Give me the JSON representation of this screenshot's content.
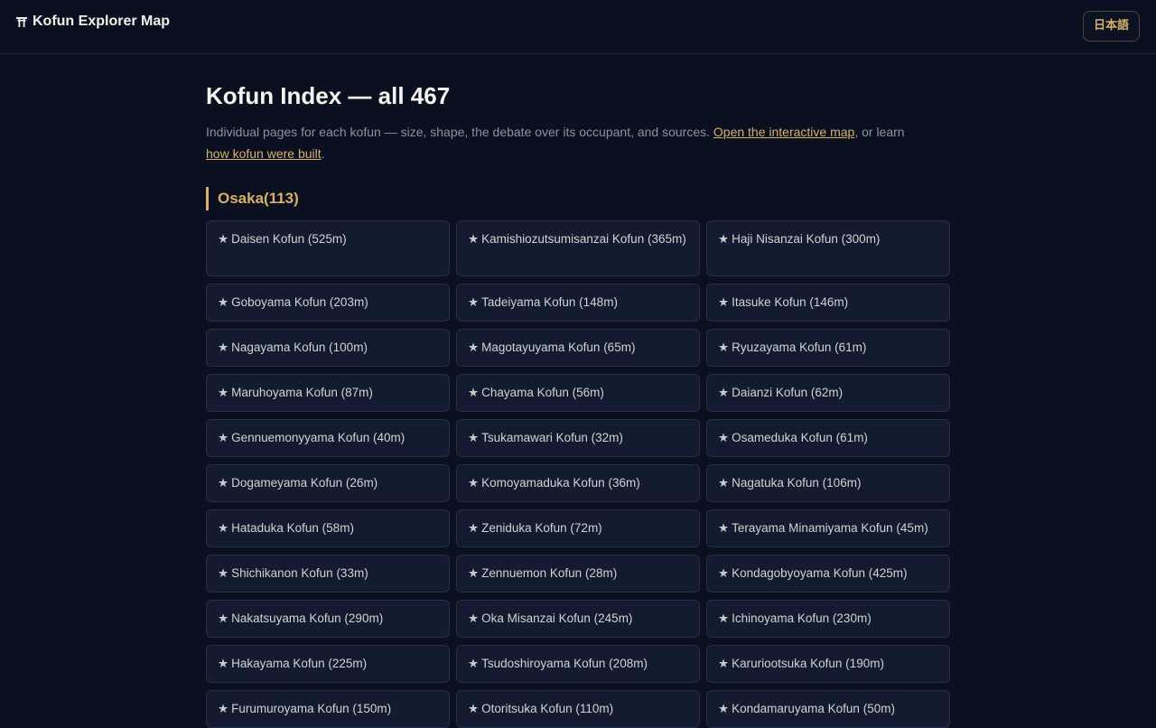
{
  "header": {
    "brand": "Kofun Explorer Map",
    "lang_button": "日本語"
  },
  "main": {
    "title": "Kofun Index — all 467",
    "intro_text": "Individual pages for each kofun — size, shape, the debate over its occupant, and sources. ",
    "map_link": "Open the interactive map",
    "intro_mid": ", or learn ",
    "build_link": "how kofun were built",
    "intro_end": "."
  },
  "region": {
    "heading": "Osaka(113)",
    "items": [
      {
        "label": "Daisen Kofun (525m)"
      },
      {
        "label": "Kamishiozutsumisanzai Kofun (365m)"
      },
      {
        "label": "Haji Nisanzai Kofun (300m)"
      },
      {
        "label": "Goboyama Kofun (203m)"
      },
      {
        "label": "Tadeiyama Kofun (148m)"
      },
      {
        "label": "Itasuke Kofun (146m)"
      },
      {
        "label": "Nagayama Kofun (100m)"
      },
      {
        "label": "Magotayuyama Kofun (65m)"
      },
      {
        "label": "Ryuzayama Kofun (61m)"
      },
      {
        "label": "Maruhoyama Kofun (87m)"
      },
      {
        "label": "Chayama Kofun (56m)"
      },
      {
        "label": "Daianzi Kofun (62m)"
      },
      {
        "label": "Gennuemonyyama Kofun (40m)"
      },
      {
        "label": "Tsukamawari Kofun (32m)"
      },
      {
        "label": "Osameduka Kofun (61m)"
      },
      {
        "label": "Dogameyama Kofun (26m)"
      },
      {
        "label": "Komoyamaduka Kofun (36m)"
      },
      {
        "label": "Nagatuka Kofun (106m)"
      },
      {
        "label": "Hataduka Kofun (58m)"
      },
      {
        "label": "Zeniduka Kofun (72m)"
      },
      {
        "label": "Terayama Minamiyama Kofun (45m)"
      },
      {
        "label": "Shichikanon Kofun (33m)"
      },
      {
        "label": "Zennuemon Kofun (28m)"
      },
      {
        "label": "Kondagobyoyama Kofun (425m)"
      },
      {
        "label": "Nakatsuyama Kofun (290m)"
      },
      {
        "label": "Oka Misanzai Kofun (245m)"
      },
      {
        "label": "Ichinoyama Kofun (230m)"
      },
      {
        "label": "Hakayama Kofun (225m)"
      },
      {
        "label": "Tsudoshiroyama Kofun (208m)"
      },
      {
        "label": "Karuriootsuka Kofun (190m)"
      },
      {
        "label": "Furumuroyama Kofun (150m)"
      },
      {
        "label": "Otoritsuka Kofun (110m)"
      },
      {
        "label": "Kondamaruyama Kofun (50m)"
      }
    ]
  }
}
